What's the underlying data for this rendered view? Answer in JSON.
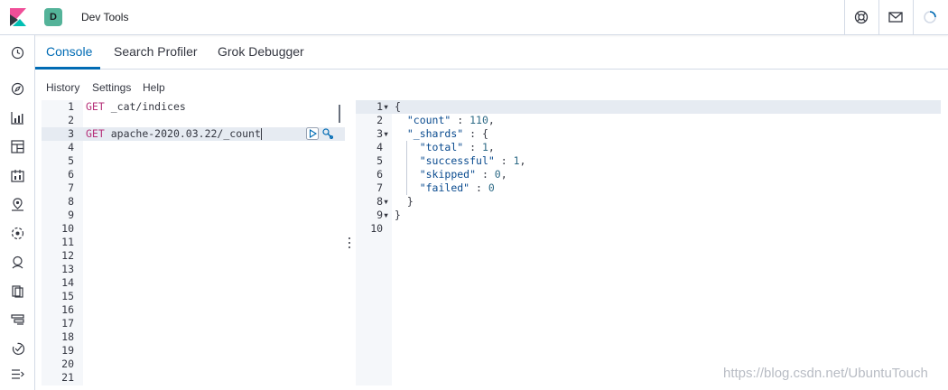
{
  "header": {
    "space_initial": "D",
    "app_title": "Dev Tools",
    "space_color": "#54b399"
  },
  "icons": {
    "logo": "kibana-logo-icon",
    "help": "help-icon",
    "news": "newsfeed-icon",
    "loading": "loading-spinner-icon",
    "nav": [
      "recently-viewed-icon",
      "discover-icon",
      "visualize-icon",
      "dashboard-icon",
      "canvas-icon",
      "maps-icon",
      "ml-icon",
      "metrics-icon",
      "logs-icon",
      "apm-icon",
      "uptime-icon",
      "collapse-menu-icon"
    ]
  },
  "tabs": [
    {
      "label": "Console",
      "active": true
    },
    {
      "label": "Search Profiler",
      "active": false
    },
    {
      "label": "Grok Debugger",
      "active": false
    }
  ],
  "submenu": [
    "History",
    "Settings",
    "Help"
  ],
  "request_editor": {
    "line_numbers": [
      "1",
      "2",
      "3",
      "4",
      "5",
      "6",
      "7",
      "8",
      "9",
      "10",
      "11",
      "12",
      "13",
      "14",
      "15",
      "16",
      "17",
      "18",
      "19",
      "20",
      "21"
    ],
    "lines": [
      {
        "method": "GET",
        "path": "_cat/indices"
      },
      {
        "method": "",
        "path": ""
      },
      {
        "method": "GET",
        "path": "apache-2020.03.22/_count"
      }
    ],
    "active_line": 3
  },
  "response_editor": {
    "line_numbers": [
      "1",
      "2",
      "3",
      "4",
      "5",
      "6",
      "7",
      "8",
      "9",
      "10"
    ],
    "fold_markers": [
      "1",
      "3",
      "8",
      "9"
    ],
    "count_key": "\"count\"",
    "count_val": "110",
    "shards_key": "\"_shards\"",
    "total_key": "\"total\"",
    "total_val": "1",
    "successful_key": "\"successful\"",
    "successful_val": "1",
    "skipped_key": "\"skipped\"",
    "skipped_val": "0",
    "failed_key": "\"failed\"",
    "failed_val": "0"
  },
  "watermark": "https://blog.csdn.net/UbuntuTouch",
  "colors": {
    "accent": "#006bb4",
    "method": "#b6317a"
  }
}
